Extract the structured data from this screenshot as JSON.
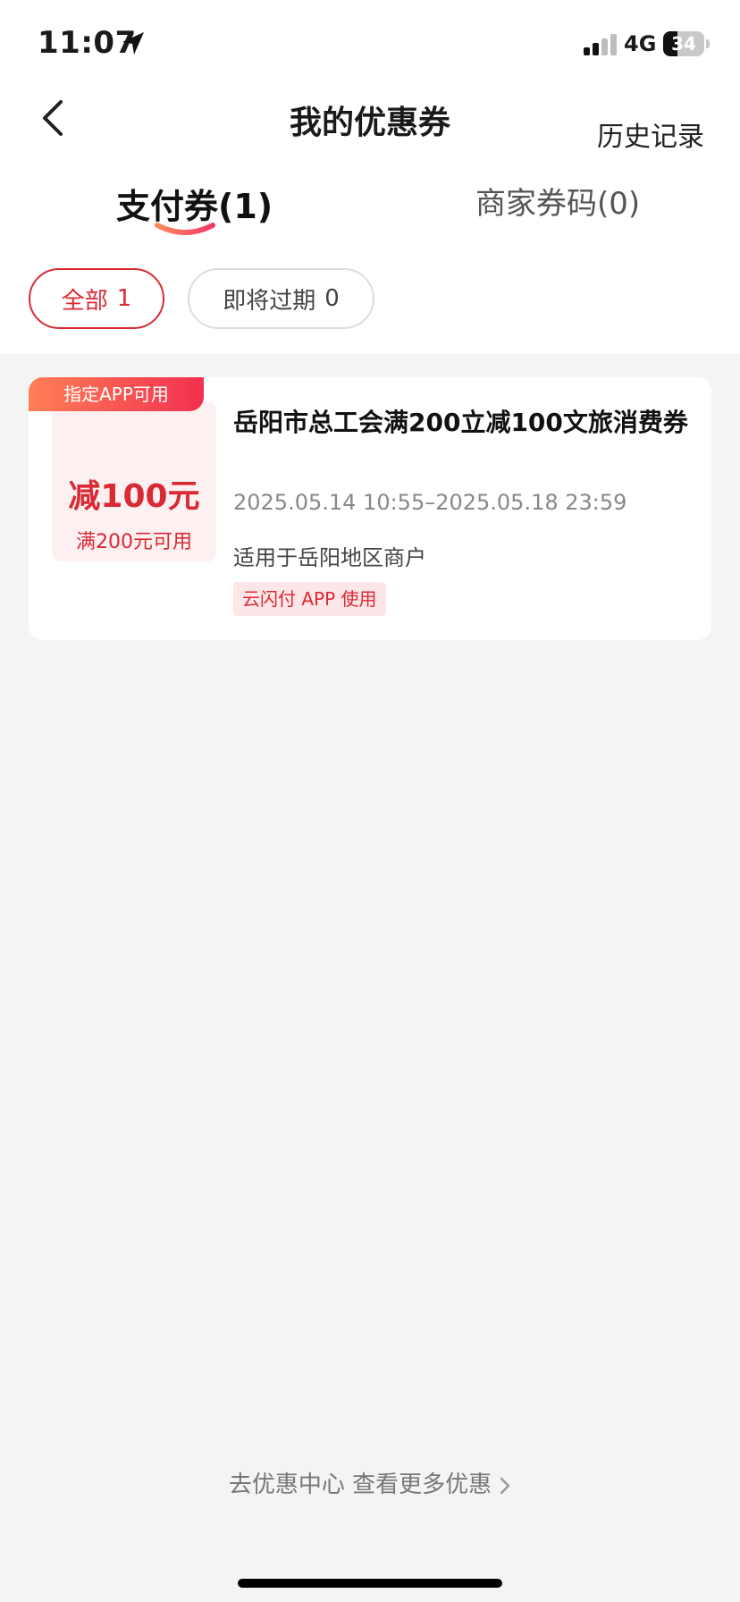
{
  "status_bar": {
    "time": "11:07",
    "network": "4G",
    "battery_level": "34",
    "battery_fraction": 0.34,
    "icons": [
      "location-arrow-icon",
      "signal-bars-icon",
      "battery-icon"
    ]
  },
  "nav": {
    "title": "我的优惠券",
    "history": "历史记录",
    "back_icon": "chevron-left-icon"
  },
  "tabs": [
    {
      "label": "支付券(1)",
      "active": true
    },
    {
      "label": "商家券码(0)",
      "active": false
    }
  ],
  "filters": [
    {
      "label": "全部",
      "count": "1",
      "active": true
    },
    {
      "label": "即将过期",
      "count": "0",
      "active": false
    }
  ],
  "coupon": {
    "tag": "指定APP可用",
    "amount": "减100元",
    "condition": "满200元可用",
    "title": "岳阳市总工会满200立减100文旅消费券",
    "validity": "2025.05.14 10:55–2025.05.18 23:59",
    "scope": "适用于岳阳地区商户",
    "badge": "云闪付 APP 使用"
  },
  "footer": {
    "more": "去优惠中心 查看更多优惠",
    "chevron_icon": "chevron-right-icon"
  },
  "colors": {
    "accent": "#d92a34",
    "background": "#f4f4f4",
    "tag_gradient_start": "#ff7f56",
    "tag_gradient_end": "#f2304f"
  }
}
